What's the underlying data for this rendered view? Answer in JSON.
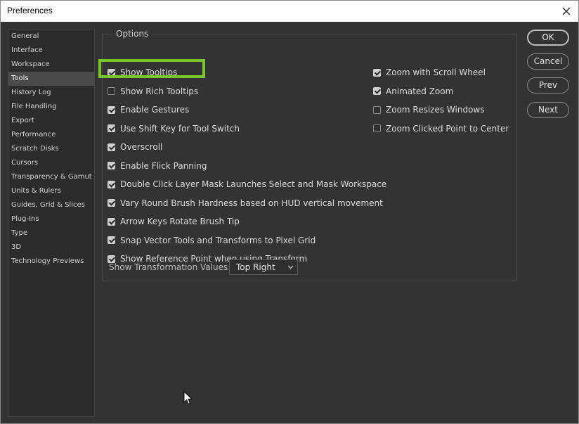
{
  "window": {
    "title": "Preferences"
  },
  "sidebar": {
    "items": [
      {
        "label": "General",
        "active": false
      },
      {
        "label": "Interface",
        "active": false
      },
      {
        "label": "Workspace",
        "active": false
      },
      {
        "label": "Tools",
        "active": true
      },
      {
        "label": "History Log",
        "active": false
      },
      {
        "label": "File Handling",
        "active": false
      },
      {
        "label": "Export",
        "active": false
      },
      {
        "label": "Performance",
        "active": false
      },
      {
        "label": "Scratch Disks",
        "active": false
      },
      {
        "label": "Cursors",
        "active": false
      },
      {
        "label": "Transparency & Gamut",
        "active": false
      },
      {
        "label": "Units & Rulers",
        "active": false
      },
      {
        "label": "Guides, Grid & Slices",
        "active": false
      },
      {
        "label": "Plug-Ins",
        "active": false
      },
      {
        "label": "Type",
        "active": false
      },
      {
        "label": "3D",
        "active": false
      },
      {
        "label": "Technology Previews",
        "active": false
      }
    ]
  },
  "options": {
    "legend": "Options",
    "left_column": [
      {
        "label": "Show Tooltips",
        "checked": true
      },
      {
        "label": "Show Rich Tooltips",
        "checked": false
      },
      {
        "label": "Enable Gestures",
        "checked": true
      },
      {
        "label": "Use Shift Key for Tool Switch",
        "checked": true
      },
      {
        "label": "Overscroll",
        "checked": true
      },
      {
        "label": "Enable Flick Panning",
        "checked": true
      },
      {
        "label": "Double Click Layer Mask Launches Select and Mask Workspace",
        "checked": true
      },
      {
        "label": "Vary Round Brush Hardness based on HUD vertical movement",
        "checked": true
      },
      {
        "label": "Arrow Keys Rotate Brush Tip",
        "checked": true
      },
      {
        "label": "Snap Vector Tools and Transforms to Pixel Grid",
        "checked": true
      },
      {
        "label": "Show Reference Point when using Transform",
        "checked": true
      }
    ],
    "right_column": [
      {
        "label": "Zoom with Scroll Wheel",
        "checked": true
      },
      {
        "label": "Animated Zoom",
        "checked": true
      },
      {
        "label": "Zoom Resizes Windows",
        "checked": false
      },
      {
        "label": "Zoom Clicked Point to Center",
        "checked": false
      }
    ],
    "transformation": {
      "label": "Show Transformation Values:",
      "value": "Top Right"
    }
  },
  "buttons": {
    "ok": "OK",
    "cancel": "Cancel",
    "prev": "Prev",
    "next": "Next"
  },
  "colors": {
    "highlight": "#7bc62d",
    "background": "#333333",
    "sidebar_active": "#4a4a4a"
  },
  "icons": {
    "close": "close-icon",
    "dropdown": "chevron-down-icon",
    "pointer": "mouse-pointer-icon"
  }
}
